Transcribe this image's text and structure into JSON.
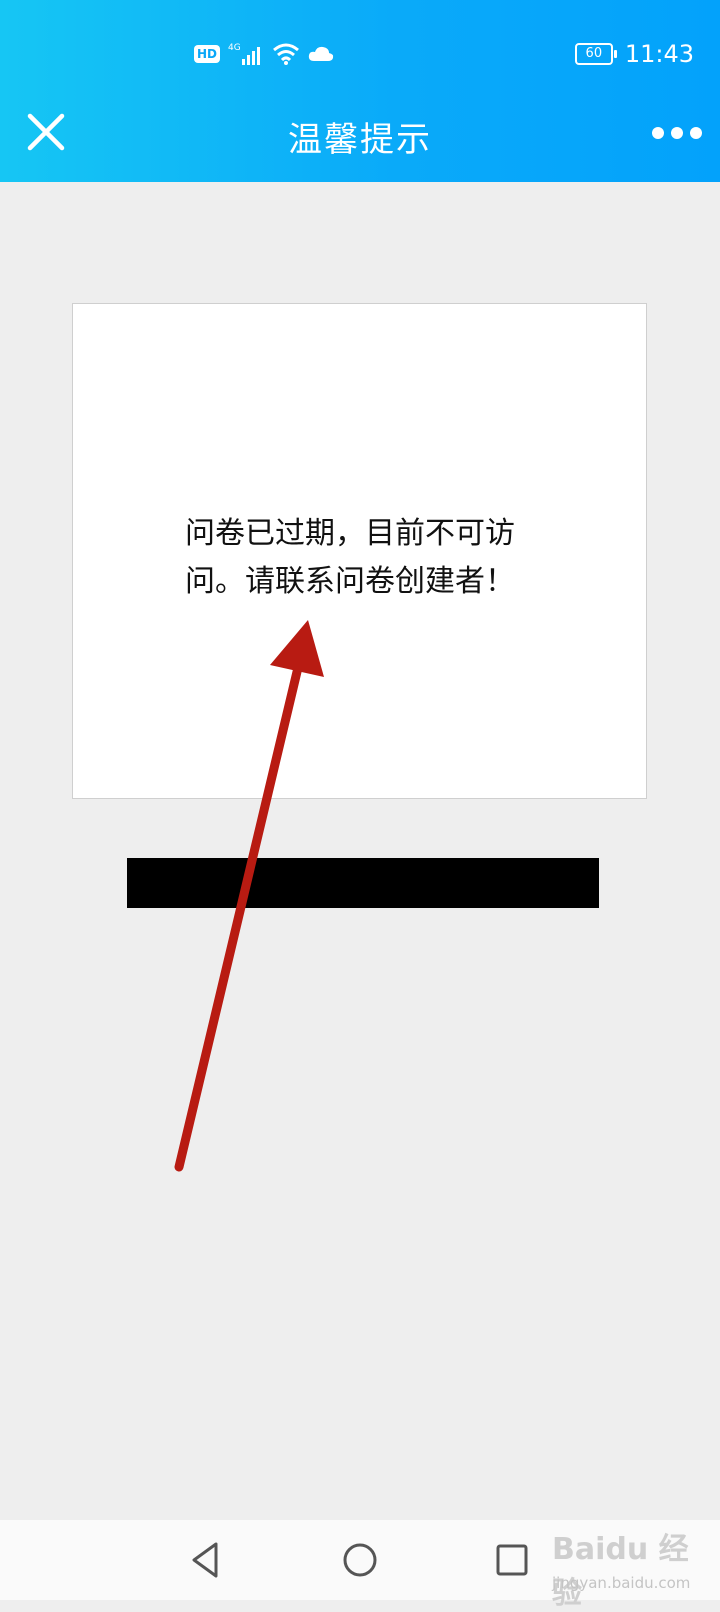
{
  "status_bar": {
    "hd_badge": "HD",
    "network": "4G",
    "battery": "60",
    "time": "11:43"
  },
  "header": {
    "title": "温馨提示",
    "close_icon": "close-icon",
    "more_icon": "more-icon"
  },
  "message": {
    "line1": "问卷已过期，目前不可访",
    "line2": "问。请联系问卷创建者！"
  },
  "bottom_nav": {
    "back_icon": "back-icon",
    "home_icon": "home-icon",
    "recent_icon": "recent-apps-icon"
  },
  "watermark": {
    "brand": "Baidu 经验",
    "url": "jingyan.baidu.com"
  },
  "colors": {
    "header_gradient_start": "#16c6f4",
    "header_gradient_end": "#03a2fb",
    "background": "#eeeeee",
    "annotation_arrow": "#b81b12"
  }
}
